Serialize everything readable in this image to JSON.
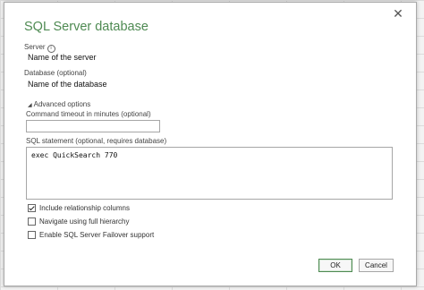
{
  "dialog": {
    "title": "SQL Server database",
    "close_glyph": "✕"
  },
  "server": {
    "label": "Server",
    "info_glyph": "i",
    "value": "Name of the server"
  },
  "database": {
    "label": "Database (optional)",
    "value": "Name of the database"
  },
  "advanced": {
    "toggle_label": "Advanced options",
    "expanded": true,
    "command_timeout": {
      "label": "Command timeout in minutes (optional)",
      "value": ""
    },
    "sql_statement": {
      "label": "SQL statement (optional, requires database)",
      "value": "exec QuickSearch 770"
    },
    "options": [
      {
        "label": "Include relationship columns",
        "checked": true
      },
      {
        "label": "Navigate using full hierarchy",
        "checked": false
      },
      {
        "label": "Enable SQL Server Failover support",
        "checked": false
      }
    ]
  },
  "buttons": {
    "ok": "OK",
    "cancel": "Cancel"
  },
  "colors": {
    "accent": "#4e8a52"
  }
}
